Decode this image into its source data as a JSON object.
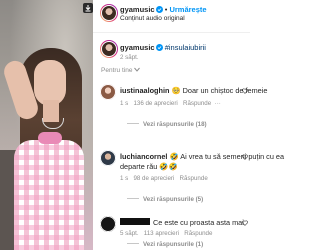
{
  "post": {
    "download_icon": "download-icon",
    "username": "gyamusic",
    "follow_label": "Urmărește",
    "audio_label": "Conținut audio original",
    "verified_icon": "verified-badge-icon",
    "caption_user": "gyamusic",
    "caption_text": "#insulaiubirii",
    "caption_time": "2 săpt.",
    "translate_label": "Pentru tine",
    "translate_icon": "chevron-down-icon"
  },
  "comments": [
    {
      "user": "iustinaaloghin",
      "text": "Doar un chiștoc de femeie",
      "emoji_icon": "pleading-face-icon",
      "age": "1 s",
      "likes": "136 de aprecieri",
      "reply_label": "Răspunde",
      "more_icon": "more-icon",
      "replies_label": "Vezi răspunsurile (18)"
    },
    {
      "user": "luchiancornel",
      "text": "Ai vrea tu să semeni puțin cu ea",
      "text_line2": "departe rău",
      "emoji_icon": "laughing-emoji-icon",
      "age": "1 s",
      "likes": "98 de aprecieri",
      "reply_label": "Răspunde",
      "replies_label": "Vezi răspunsurile (5)"
    },
    {
      "user": "[redacted]",
      "text": "Ce este cu proasta asta mai",
      "age": "5 săpt.",
      "likes": "113 aprecieri",
      "reply_label": "Răspunde",
      "replies_label": "Vezi răspunsurile (1)"
    }
  ],
  "colors": {
    "accent": "#0095f6",
    "text": "#262626",
    "muted": "#8e8e8e",
    "link": "#00376b"
  }
}
